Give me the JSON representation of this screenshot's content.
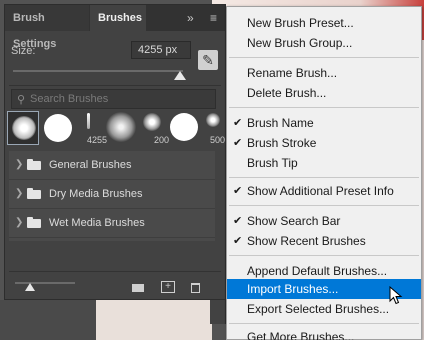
{
  "panel": {
    "tabs": [
      {
        "label": "Brush Settings"
      },
      {
        "label": "Brushes"
      }
    ],
    "collapse_glyph": "»",
    "menu_glyph": "≡",
    "size": {
      "label": "Size:",
      "value": "4255 px",
      "slider_fraction": 0.98
    },
    "search": {
      "placeholder": "Search Brushes"
    },
    "recent_brushes": [
      {
        "label": ""
      },
      {
        "label": ""
      },
      {
        "label": "4255"
      },
      {
        "label": ""
      },
      {
        "label": "200"
      },
      {
        "label": ""
      },
      {
        "label": "500"
      }
    ],
    "groups": [
      {
        "label": "General Brushes"
      },
      {
        "label": "Dry Media Brushes"
      },
      {
        "label": "Wet Media Brushes"
      }
    ],
    "thumb_size_fraction": 0.25
  },
  "menu": {
    "items": [
      {
        "label": "New Brush Preset...",
        "checked": false
      },
      {
        "label": "New Brush Group...",
        "checked": false
      },
      {
        "label": "Rename Brush...",
        "checked": false
      },
      {
        "label": "Delete Brush...",
        "checked": false
      },
      {
        "label": "Brush Name",
        "checked": true
      },
      {
        "label": "Brush Stroke",
        "checked": true
      },
      {
        "label": "Brush Tip",
        "checked": false
      },
      {
        "label": "Show Additional Preset Info",
        "checked": true
      },
      {
        "label": "Show Search Bar",
        "checked": true
      },
      {
        "label": "Show Recent Brushes",
        "checked": true
      },
      {
        "label": "Append Default Brushes...",
        "checked": false
      },
      {
        "label": "Import Brushes...",
        "checked": false,
        "highlighted": true
      },
      {
        "label": "Export Selected Brushes...",
        "checked": false
      },
      {
        "label": "Get More Brushes...",
        "checked": false
      }
    ],
    "check_glyph": "✔",
    "highlight_color": "#0078d7"
  },
  "colors": {
    "panel_bg": "#424242",
    "tab_bar": "#323232",
    "menu_bg": "#f0f0f0",
    "accent": "#0078d7"
  }
}
